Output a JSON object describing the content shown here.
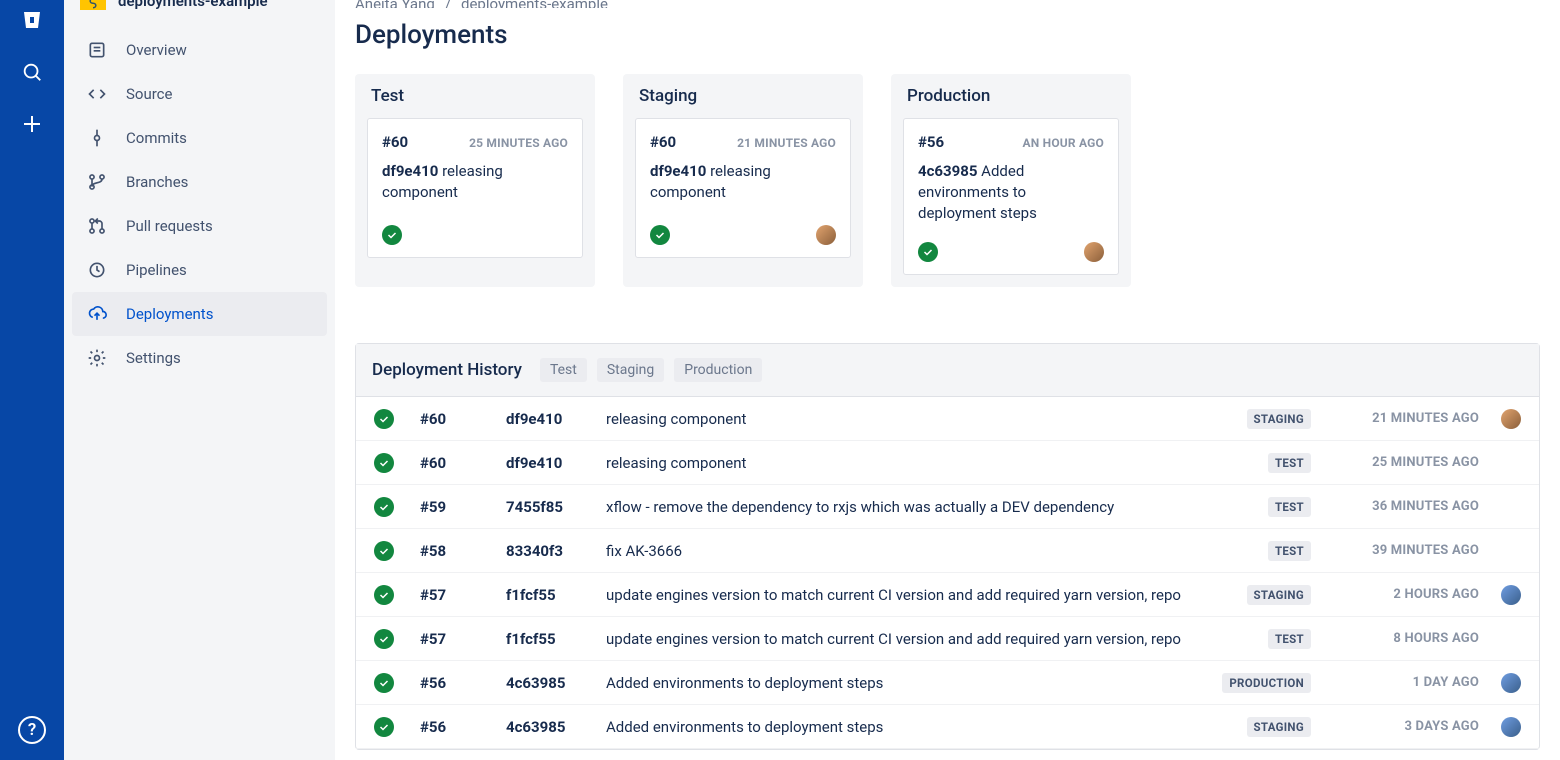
{
  "breadcrumb": {
    "owner": "Aneita Yang",
    "repo": "deployments-example"
  },
  "page_title": "Deployments",
  "project_name": "deployments-example",
  "rail": {
    "help_label": "?"
  },
  "sidebar": {
    "items": [
      {
        "label": "Overview"
      },
      {
        "label": "Source"
      },
      {
        "label": "Commits"
      },
      {
        "label": "Branches"
      },
      {
        "label": "Pull requests"
      },
      {
        "label": "Pipelines"
      },
      {
        "label": "Deployments"
      },
      {
        "label": "Settings"
      }
    ]
  },
  "environments": [
    {
      "name": "Test",
      "build": "#60",
      "time": "25 MINUTES AGO",
      "hash": "df9e410",
      "message": "releasing component",
      "show_avatar": false,
      "avatar_alt": false
    },
    {
      "name": "Staging",
      "build": "#60",
      "time": "21 MINUTES AGO",
      "hash": "df9e410",
      "message": "releasing component",
      "show_avatar": true,
      "avatar_alt": false
    },
    {
      "name": "Production",
      "build": "#56",
      "time": "AN HOUR AGO",
      "hash": "4c63985",
      "message": "Added environments to deployment steps",
      "show_avatar": true,
      "avatar_alt": false
    }
  ],
  "history": {
    "title": "Deployment History",
    "filters": [
      "Test",
      "Staging",
      "Production"
    ],
    "rows": [
      {
        "build": "#60",
        "hash": "df9e410",
        "message": "releasing component",
        "env": "STAGING",
        "time": "21 MINUTES AGO",
        "show_avatar": true,
        "avatar_alt": false
      },
      {
        "build": "#60",
        "hash": "df9e410",
        "message": "releasing component",
        "env": "TEST",
        "time": "25 MINUTES AGO",
        "show_avatar": false,
        "avatar_alt": false
      },
      {
        "build": "#59",
        "hash": "7455f85",
        "message": "xflow - remove the dependency to rxjs which was actually a DEV dependency",
        "env": "TEST",
        "time": "36 MINUTES AGO",
        "show_avatar": false,
        "avatar_alt": false
      },
      {
        "build": "#58",
        "hash": "83340f3",
        "message": "fix AK-3666",
        "env": "TEST",
        "time": "39 MINUTES AGO",
        "show_avatar": false,
        "avatar_alt": false
      },
      {
        "build": "#57",
        "hash": "f1fcf55",
        "message": "update engines version to match current CI version and add required yarn version, repo",
        "env": "STAGING",
        "time": "2 HOURS AGO",
        "show_avatar": true,
        "avatar_alt": true
      },
      {
        "build": "#57",
        "hash": "f1fcf55",
        "message": "update engines version to match current CI version and add required yarn version, repo",
        "env": "TEST",
        "time": "8 HOURS AGO",
        "show_avatar": false,
        "avatar_alt": false
      },
      {
        "build": "#56",
        "hash": "4c63985",
        "message": "Added environments to deployment steps",
        "env": "PRODUCTION",
        "time": "1 DAY AGO",
        "show_avatar": true,
        "avatar_alt": true
      },
      {
        "build": "#56",
        "hash": "4c63985",
        "message": "Added environments to deployment steps",
        "env": "STAGING",
        "time": "3 DAYS AGO",
        "show_avatar": true,
        "avatar_alt": true
      }
    ]
  }
}
